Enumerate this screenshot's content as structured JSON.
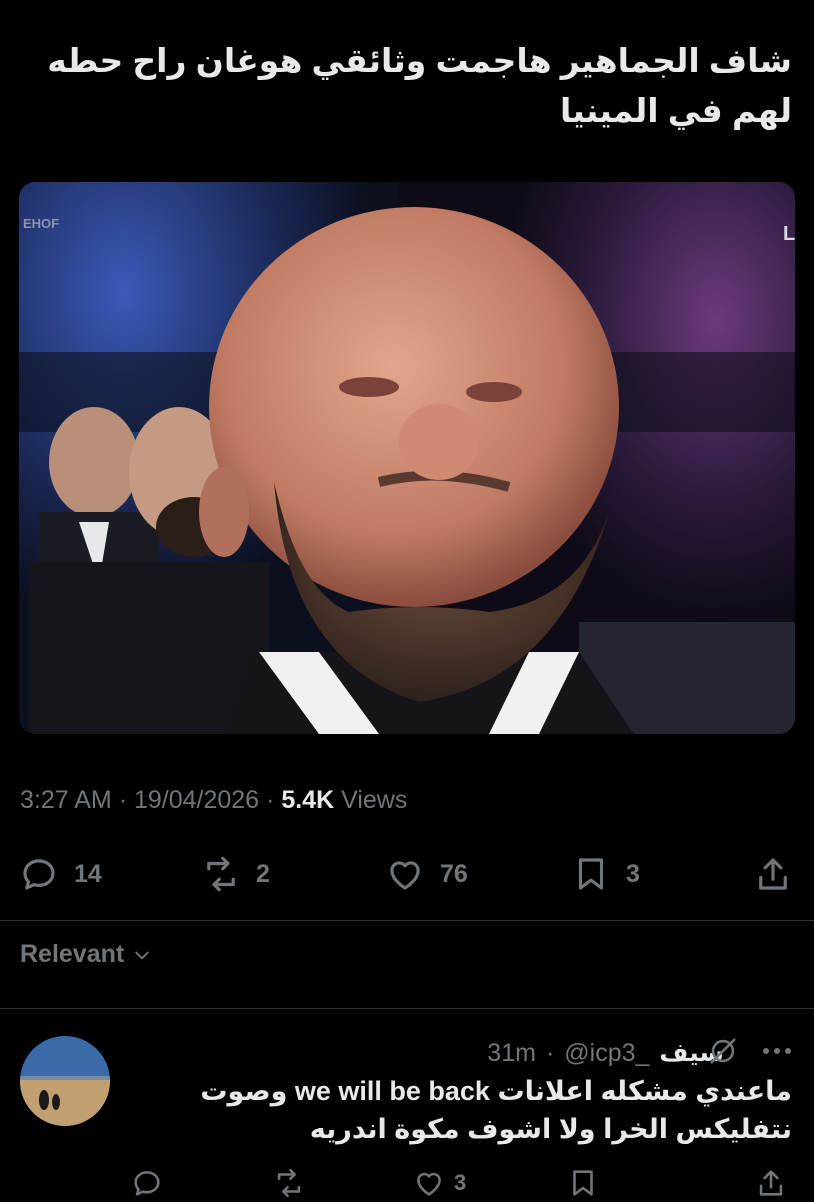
{
  "tweet": {
    "text_line1": "شاف الجماهير هاجمت وثائقي هوغان راح حطه",
    "text_line2": "لهم في المينيا",
    "media": {
      "corner_text_left": "EHOF",
      "corner_text_right": "L"
    },
    "time": "3:27 AM",
    "separator": "·",
    "date": "19/04/2026",
    "views_count": "5.4K",
    "views_label": "Views",
    "actions": {
      "replies": "14",
      "reposts": "2",
      "likes": "76",
      "bookmarks": "3"
    }
  },
  "sort": {
    "label": "Relevant",
    "icon": "chevron-down-icon"
  },
  "reply": {
    "name": "سيف",
    "handle": "@icp3_",
    "separator": "·",
    "time": "31m",
    "text_line1": "ماعندي مشكله اعلانات we will be back وصوت",
    "text_line2": "نتفليكس الخرا ولا اشوف مكوة اندريه",
    "actions": {
      "likes": "3"
    }
  },
  "colors": {
    "background": "#000000",
    "text": "#e7e9ea",
    "secondary": "#71767b",
    "divider": "#2f3336"
  },
  "icons": [
    "comment-icon",
    "repost-icon",
    "heart-icon",
    "bookmark-icon",
    "share-icon",
    "mute-icon",
    "more-icon"
  ]
}
